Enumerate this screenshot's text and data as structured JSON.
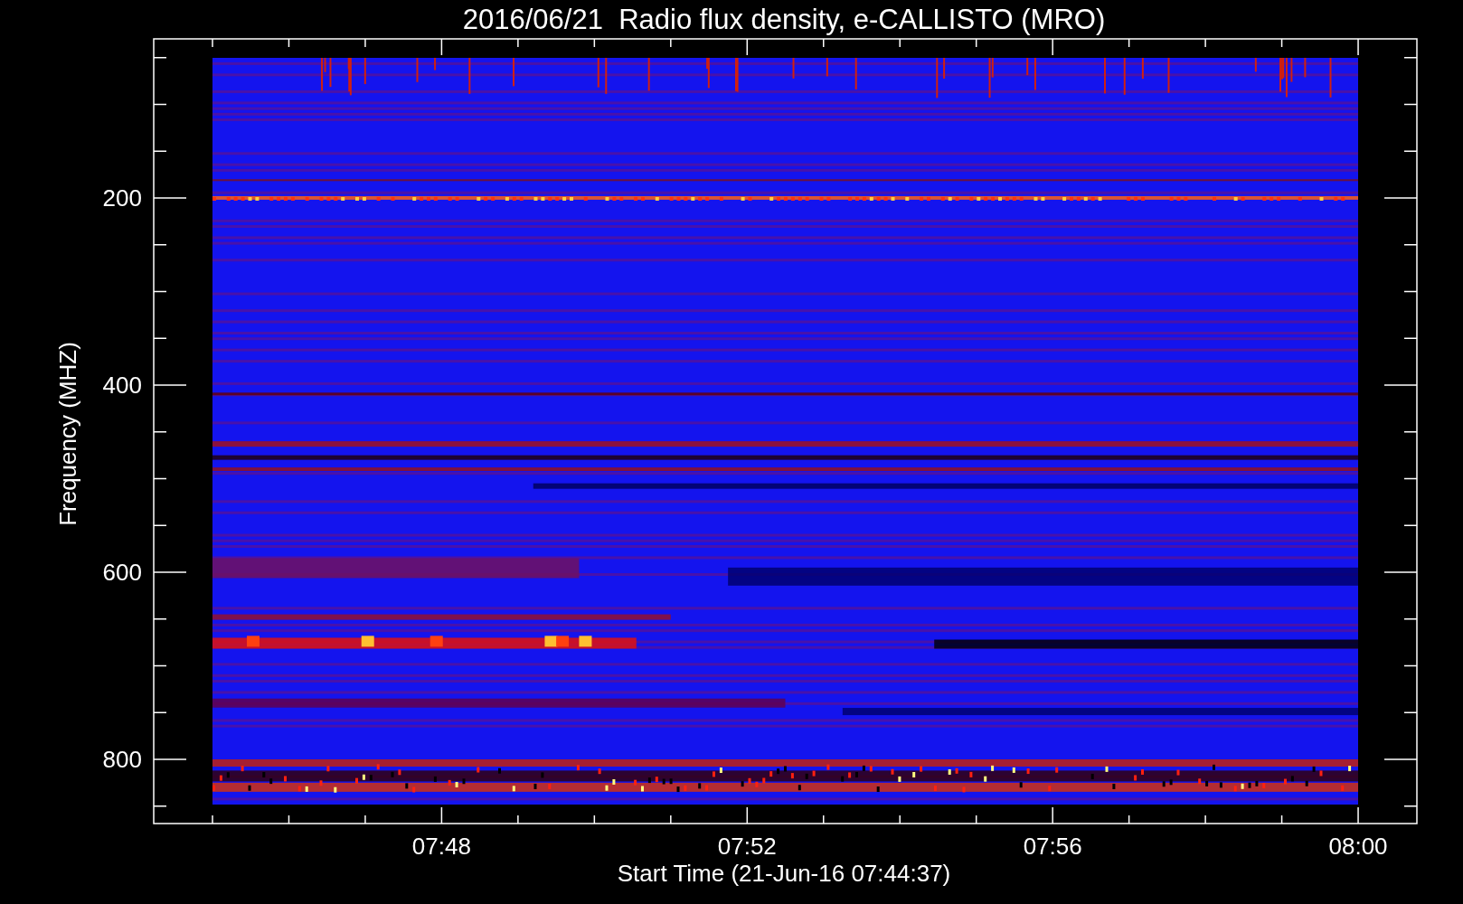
{
  "title": "2016/06/21  Radio flux density, e-CALLISTO (MRO)",
  "plot": {
    "ylabel": "Frequency (MHZ)",
    "xlabel": "Start Time (21-Jun-16 07:44:37)",
    "yticks": [
      "200",
      "400",
      "600",
      "800"
    ],
    "xticks": [
      "07:48",
      "07:52",
      "07:56",
      "08:00"
    ]
  }
}
